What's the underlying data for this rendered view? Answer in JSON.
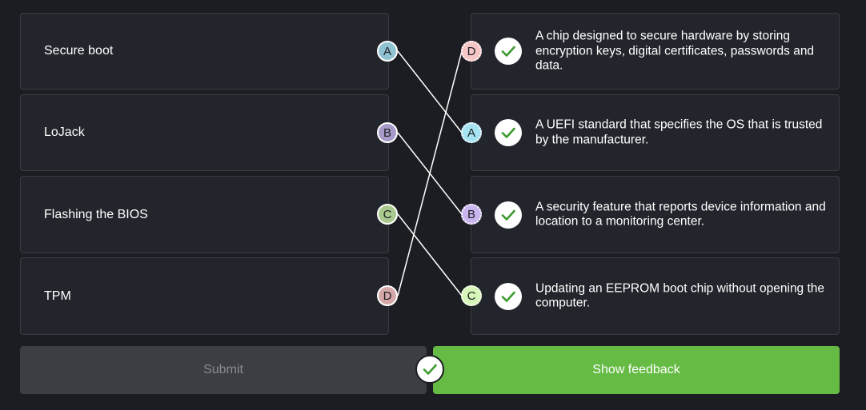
{
  "left_items": [
    {
      "label": "Secure boot",
      "letter": "A",
      "color": "#8fc3d1"
    },
    {
      "label": "LoJack",
      "letter": "B",
      "color": "#a79bc9"
    },
    {
      "label": "Flashing the BIOS",
      "letter": "C",
      "color": "#a9c98e"
    },
    {
      "label": "TPM",
      "letter": "D",
      "color": "#d4a8a8"
    }
  ],
  "right_items": [
    {
      "letter": "D",
      "color": "#f6c6c6",
      "text": "A chip designed to secure hardware by storing encryption keys, digital certificates, passwords and data."
    },
    {
      "letter": "A",
      "color": "#a6e3f2",
      "text": "A UEFI standard that specifies the OS that is trusted by the manufacturer."
    },
    {
      "letter": "B",
      "color": "#c9b6ef",
      "text": "A security feature that reports device information and location to a monitoring center."
    },
    {
      "letter": "C",
      "color": "#d6f5b8",
      "text": "Updating an EEPROM boot chip without opening the computer."
    }
  ],
  "buttons": {
    "submit_label": "Submit",
    "feedback_label": "Show feedback"
  },
  "colors": {
    "background": "#1c1d22",
    "card": "#23252c",
    "check_green": "#3c9a2f",
    "feedback_green": "#65bb44"
  },
  "icons": {
    "check": "checkmark-icon"
  }
}
